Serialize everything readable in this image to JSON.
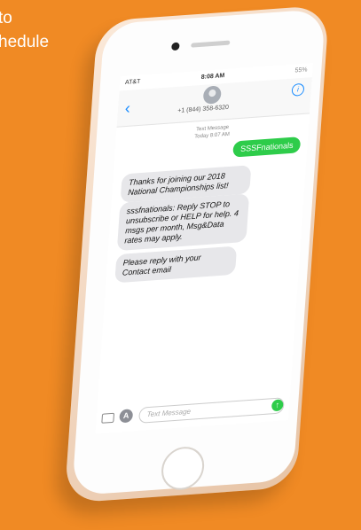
{
  "background": {
    "line1": "to",
    "line2": "hedule",
    "color": "#f08a24"
  },
  "status_bar": {
    "carrier": "AT&T",
    "time": "8:08 AM",
    "battery": "55%"
  },
  "header": {
    "contact": "+1 (844) 358-6320"
  },
  "thread": {
    "meta": "Text Message",
    "meta_time": "Today 8:07 AM",
    "sent": "SSSFnationals",
    "received": [
      "Thanks for joining our 2018 National Championships list!",
      "sssfnationals: Reply STOP to unsubscribe or HELP for help. 4 msgs per month, Msg&Data rates may apply.",
      "Please reply with your Contact email"
    ]
  },
  "composer": {
    "placeholder": "Text Message"
  },
  "icons": {
    "back": "chevron-left-icon",
    "info": "info-icon",
    "camera": "camera-icon",
    "appstore": "appstore-icon",
    "send": "send-arrow-icon"
  }
}
